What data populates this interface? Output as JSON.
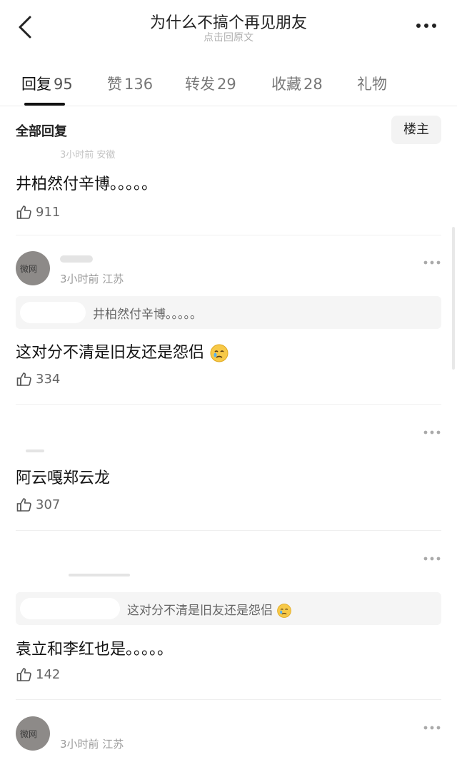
{
  "header": {
    "title": "为什么不搞个再见朋友",
    "subtitle": "点击回原文"
  },
  "tabs": [
    {
      "label": "回复",
      "count": "95",
      "active": true
    },
    {
      "label": "赞",
      "count": "136",
      "active": false
    },
    {
      "label": "转发",
      "count": "29",
      "active": false
    },
    {
      "label": "收藏",
      "count": "28",
      "active": false
    },
    {
      "label": "礼物",
      "count": "",
      "active": false
    }
  ],
  "filter": {
    "title": "全部回复",
    "owner_button": "楼主"
  },
  "comments": [
    {
      "meta": "3小时前 安徽",
      "text": "井柏然付辛博。。。。。",
      "likes": "911"
    },
    {
      "meta": "3小时前 江苏",
      "quote": "井柏然付辛博。。。。。",
      "text": "这对分不清是旧友还是怨侣",
      "likes": "334",
      "avatar_label": "微网"
    },
    {
      "text": "阿云嘎郑云龙",
      "likes": "307"
    },
    {
      "quote": "这对分不清是旧友还是怨侣",
      "text": "袁立和李红也是。。。。。",
      "likes": "142"
    },
    {
      "meta": "3小时前 江苏",
      "avatar_label": "微网"
    }
  ],
  "colors": {
    "text_primary": "#111111",
    "text_secondary": "#9a9a9a",
    "quote_bg": "#f5f5f5",
    "divider": "#efefef"
  }
}
